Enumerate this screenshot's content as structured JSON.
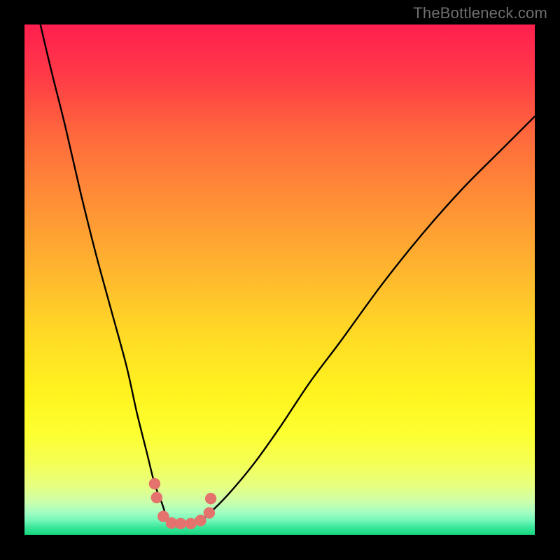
{
  "watermark": "TheBottleneck.com",
  "colors": {
    "black": "#000000",
    "curve": "#000000",
    "marker": "#e4726d",
    "marker_stroke": "#d8615c"
  },
  "chart_data": {
    "type": "line",
    "title": "",
    "xlabel": "",
    "ylabel": "",
    "xlim": [
      0,
      100
    ],
    "ylim": [
      0,
      100
    ],
    "grid": false,
    "legend": false,
    "series": [
      {
        "name": "bottleneck-curve",
        "x": [
          0,
          2,
          5,
          8,
          11,
          14,
          17,
          20,
          22,
          24,
          25.5,
          27,
          28,
          29,
          30,
          32,
          34,
          36,
          40,
          45,
          50,
          56,
          62,
          70,
          78,
          86,
          94,
          100
        ],
        "y": [
          115,
          105,
          92,
          80,
          67,
          55,
          44,
          33,
          24,
          16,
          10,
          6,
          3,
          2.3,
          2.2,
          2.2,
          2.5,
          4,
          8,
          14,
          21,
          30,
          38,
          49,
          59,
          68,
          76,
          82
        ]
      }
    ],
    "markers": [
      {
        "x": 25.5,
        "y": 10.0
      },
      {
        "x": 25.9,
        "y": 7.3
      },
      {
        "x": 27.2,
        "y": 3.6
      },
      {
        "x": 28.8,
        "y": 2.3
      },
      {
        "x": 30.6,
        "y": 2.2
      },
      {
        "x": 32.6,
        "y": 2.2
      },
      {
        "x": 34.5,
        "y": 2.8
      },
      {
        "x": 36.2,
        "y": 4.3
      },
      {
        "x": 36.5,
        "y": 7.1
      }
    ],
    "background_gradient": {
      "type": "vertical",
      "stops": [
        {
          "offset": 0.0,
          "color": "#ff1f4f"
        },
        {
          "offset": 0.1,
          "color": "#ff3a47"
        },
        {
          "offset": 0.22,
          "color": "#ff6a3c"
        },
        {
          "offset": 0.35,
          "color": "#ff9036"
        },
        {
          "offset": 0.48,
          "color": "#ffb52f"
        },
        {
          "offset": 0.6,
          "color": "#ffd826"
        },
        {
          "offset": 0.72,
          "color": "#fff31f"
        },
        {
          "offset": 0.8,
          "color": "#fdff30"
        },
        {
          "offset": 0.86,
          "color": "#f4ff55"
        },
        {
          "offset": 0.905,
          "color": "#e6ff82"
        },
        {
          "offset": 0.935,
          "color": "#ccffab"
        },
        {
          "offset": 0.955,
          "color": "#a7fec2"
        },
        {
          "offset": 0.972,
          "color": "#72f7b8"
        },
        {
          "offset": 0.985,
          "color": "#3ae79a"
        },
        {
          "offset": 1.0,
          "color": "#16d87f"
        }
      ]
    }
  }
}
